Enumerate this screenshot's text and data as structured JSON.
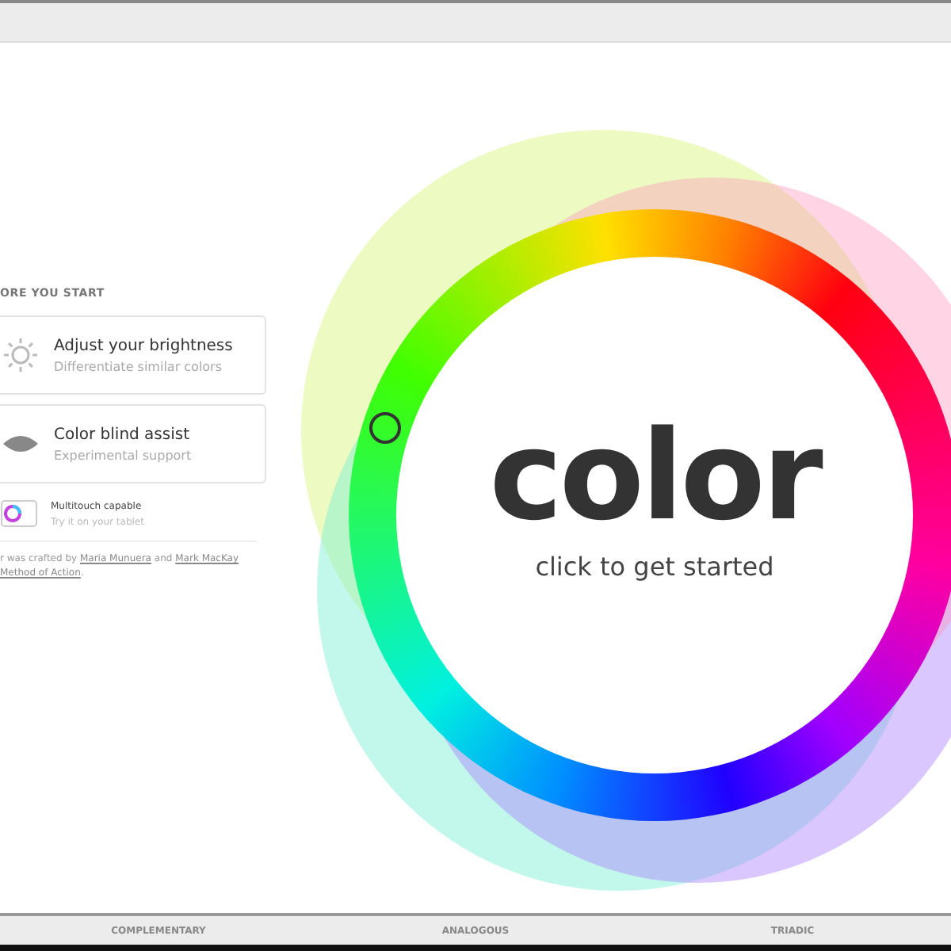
{
  "intro": {
    "heading": "ORE YOU START",
    "options": [
      {
        "kind": "brightness",
        "title": "Adjust your brightness",
        "subtitle": "Differentiate similar colors"
      },
      {
        "kind": "eye",
        "title": "Color blind assist",
        "subtitle": "Experimental support"
      }
    ],
    "multitouch": {
      "title": "Multitouch capable",
      "subtitle": "Try it on your tablet"
    },
    "credits": {
      "lead": "r was crafted by",
      "name_1": "Maria Munuera",
      "joiner": "and",
      "name_2": "Mark MacKay",
      "name_3": "Method of Action",
      "end": "."
    }
  },
  "hero": {
    "title": "color",
    "subtitle": "click to get started"
  },
  "modes": [
    {
      "label": "COMPLEMENTARY"
    },
    {
      "label": "ANALOGOUS"
    },
    {
      "label": "TRIADIC"
    }
  ]
}
